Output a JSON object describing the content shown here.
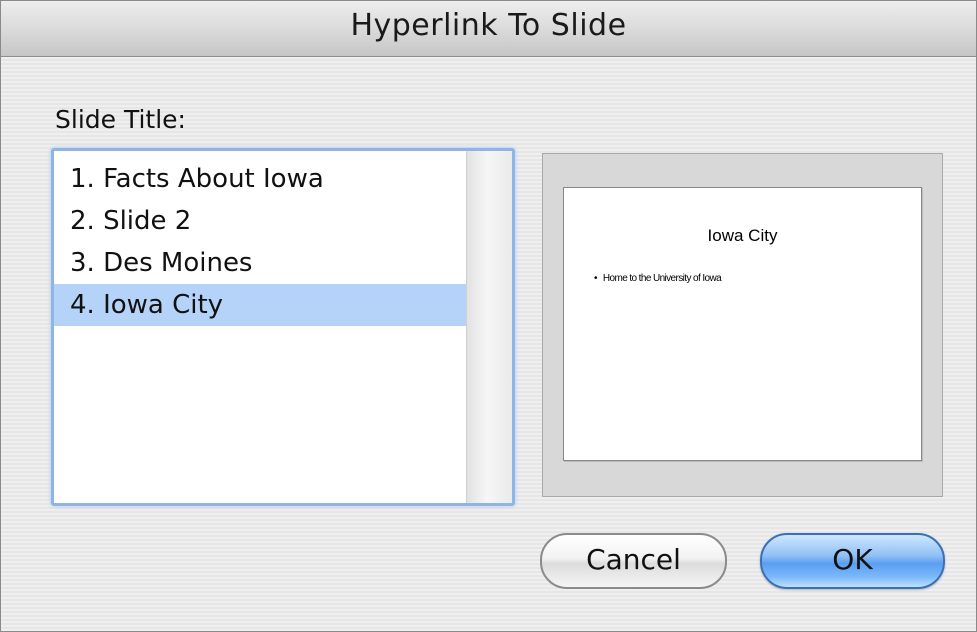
{
  "window": {
    "title": "Hyperlink To Slide"
  },
  "slide_list": {
    "label": "Slide Title:",
    "items": [
      {
        "label": "1. Facts About Iowa",
        "selected": false
      },
      {
        "label": "2. Slide 2",
        "selected": false
      },
      {
        "label": "3. Des Moines",
        "selected": false
      },
      {
        "label": "4. Iowa City",
        "selected": true
      }
    ]
  },
  "preview": {
    "slide_title": "Iowa City",
    "bullets": [
      "Home to the University of Iowa"
    ]
  },
  "buttons": {
    "cancel_label": "Cancel",
    "ok_label": "OK"
  },
  "colors": {
    "selection": "#b5d3f8",
    "focus_ring": "#8fb5e6",
    "default_button": "#5a9ef0"
  }
}
